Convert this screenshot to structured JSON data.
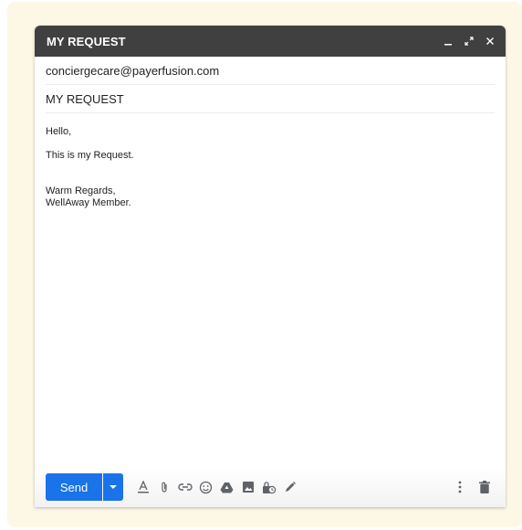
{
  "window": {
    "title": "MY REQUEST"
  },
  "fields": {
    "to": "conciergecare@payerfusion.com",
    "subject": "MY REQUEST"
  },
  "message": {
    "greeting": "Hello,",
    "content": "This is my Request.",
    "closing": "Warm Regards,",
    "signature": "WellAway Member."
  },
  "footer": {
    "send_label": "Send"
  },
  "colors": {
    "titlebar": "#404040",
    "send_button": "#1a73e8",
    "frame_background": "#fdf7e6",
    "icon": "#5f6368"
  },
  "icons": {
    "titlebar": [
      "minimize-icon",
      "expand-icon",
      "close-icon"
    ],
    "toolbar": [
      "text-format-icon",
      "attach-icon",
      "link-icon",
      "emoji-icon",
      "drive-icon",
      "photo-icon",
      "confidential-icon",
      "signature-icon"
    ],
    "right": [
      "more-options-icon",
      "delete-icon"
    ]
  }
}
